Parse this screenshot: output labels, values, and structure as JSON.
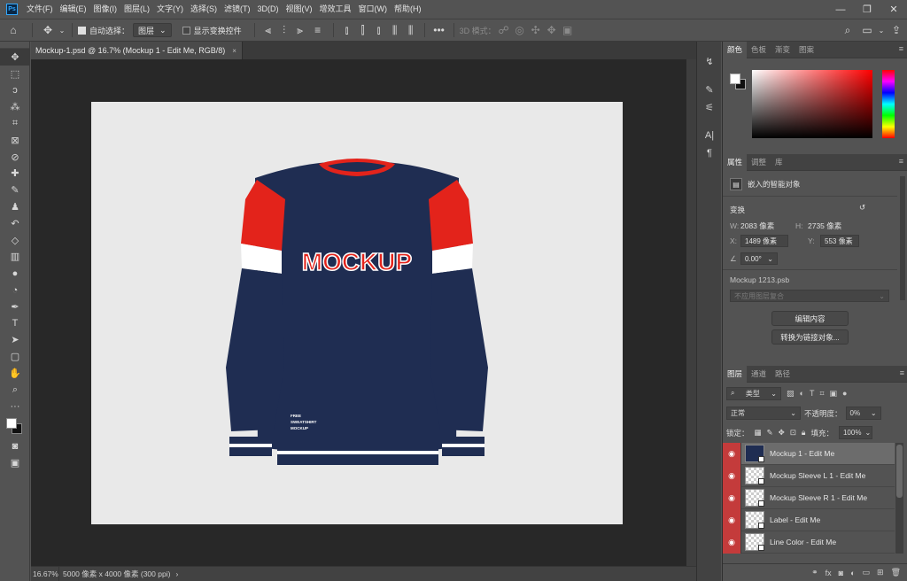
{
  "menubar": {
    "items": [
      "文件(F)",
      "编辑(E)",
      "图像(I)",
      "图层(L)",
      "文字(Y)",
      "选择(S)",
      "滤镜(T)",
      "3D(D)",
      "视图(V)",
      "增效工具",
      "窗口(W)",
      "帮助(H)"
    ],
    "logo": "Ps"
  },
  "options_bar": {
    "auto_select_label": "自动选择：",
    "auto_select_target": "图层",
    "show_transform_label": "显示变换控件",
    "mode_3d_label": "3D 模式："
  },
  "document": {
    "tab_title": "Mockup-1.psd @ 16.7% (Mockup 1 - Edit Me, RGB/8)",
    "tab_close": "×"
  },
  "status": {
    "zoom": "16.67%",
    "info": "5000 像素 x 4000 像素 (300 ppi)",
    "arrow": "›"
  },
  "mockup": {
    "chest_text": "MOCKUP",
    "label_lines": [
      "FREE",
      "SWEATSHIRT",
      "MOCKUP"
    ]
  },
  "color_panel": {
    "tabs": [
      "颜色",
      "色板",
      "渐变",
      "图案"
    ]
  },
  "properties_panel": {
    "tabs": [
      "属性",
      "调整",
      "库"
    ],
    "object_type": "嵌入的智能对象",
    "section_transform": "变换",
    "w_label": "W:",
    "w_value": "2083 像素",
    "h_label": "H:",
    "h_value": "2735 像素",
    "x_label": "X:",
    "x_value": "1489 像素",
    "y_label": "Y:",
    "y_value": "553 像素",
    "angle_value": "0.00°",
    "file_name": "Mockup 1213.psb",
    "comp_placeholder": "不应用图层复合",
    "edit_contents_button": "编辑内容",
    "convert_linked_button": "转换为链接对象..."
  },
  "layers_panel": {
    "tabs": [
      "图层",
      "通道",
      "路径"
    ],
    "filter_kind": "类型",
    "blend_mode": "正常",
    "opacity_label": "不透明度：",
    "opacity_value": "0%",
    "lock_label": "锁定：",
    "fill_label": "填充：",
    "fill_value": "100%",
    "layers": [
      {
        "name": "Mockup 1 - Edit Me",
        "selected": true
      },
      {
        "name": "Mockup Sleeve L 1 - Edit Me",
        "selected": false
      },
      {
        "name": "Mockup Sleeve R 1 - Edit Me",
        "selected": false
      },
      {
        "name": "Label - Edit Me",
        "selected": false
      },
      {
        "name": "Line Color - Edit Me",
        "selected": false
      }
    ]
  },
  "colors": {
    "navy": "#1f2d52",
    "red": "#e3231b",
    "eye_red": "#c43b3b"
  },
  "icons": {
    "toolbar": [
      "move-icon",
      "marquee-icon",
      "lasso-icon",
      "magic-wand-icon",
      "crop-icon",
      "frame-icon",
      "eyedropper-icon",
      "healing-brush-icon",
      "brush-icon",
      "clone-stamp-icon",
      "history-brush-icon",
      "eraser-icon",
      "gradient-icon",
      "blur-icon",
      "dodge-icon",
      "pen-icon",
      "type-icon",
      "path-select-icon",
      "shape-icon",
      "hand-icon",
      "zoom-icon",
      "more-tools-icon"
    ]
  }
}
